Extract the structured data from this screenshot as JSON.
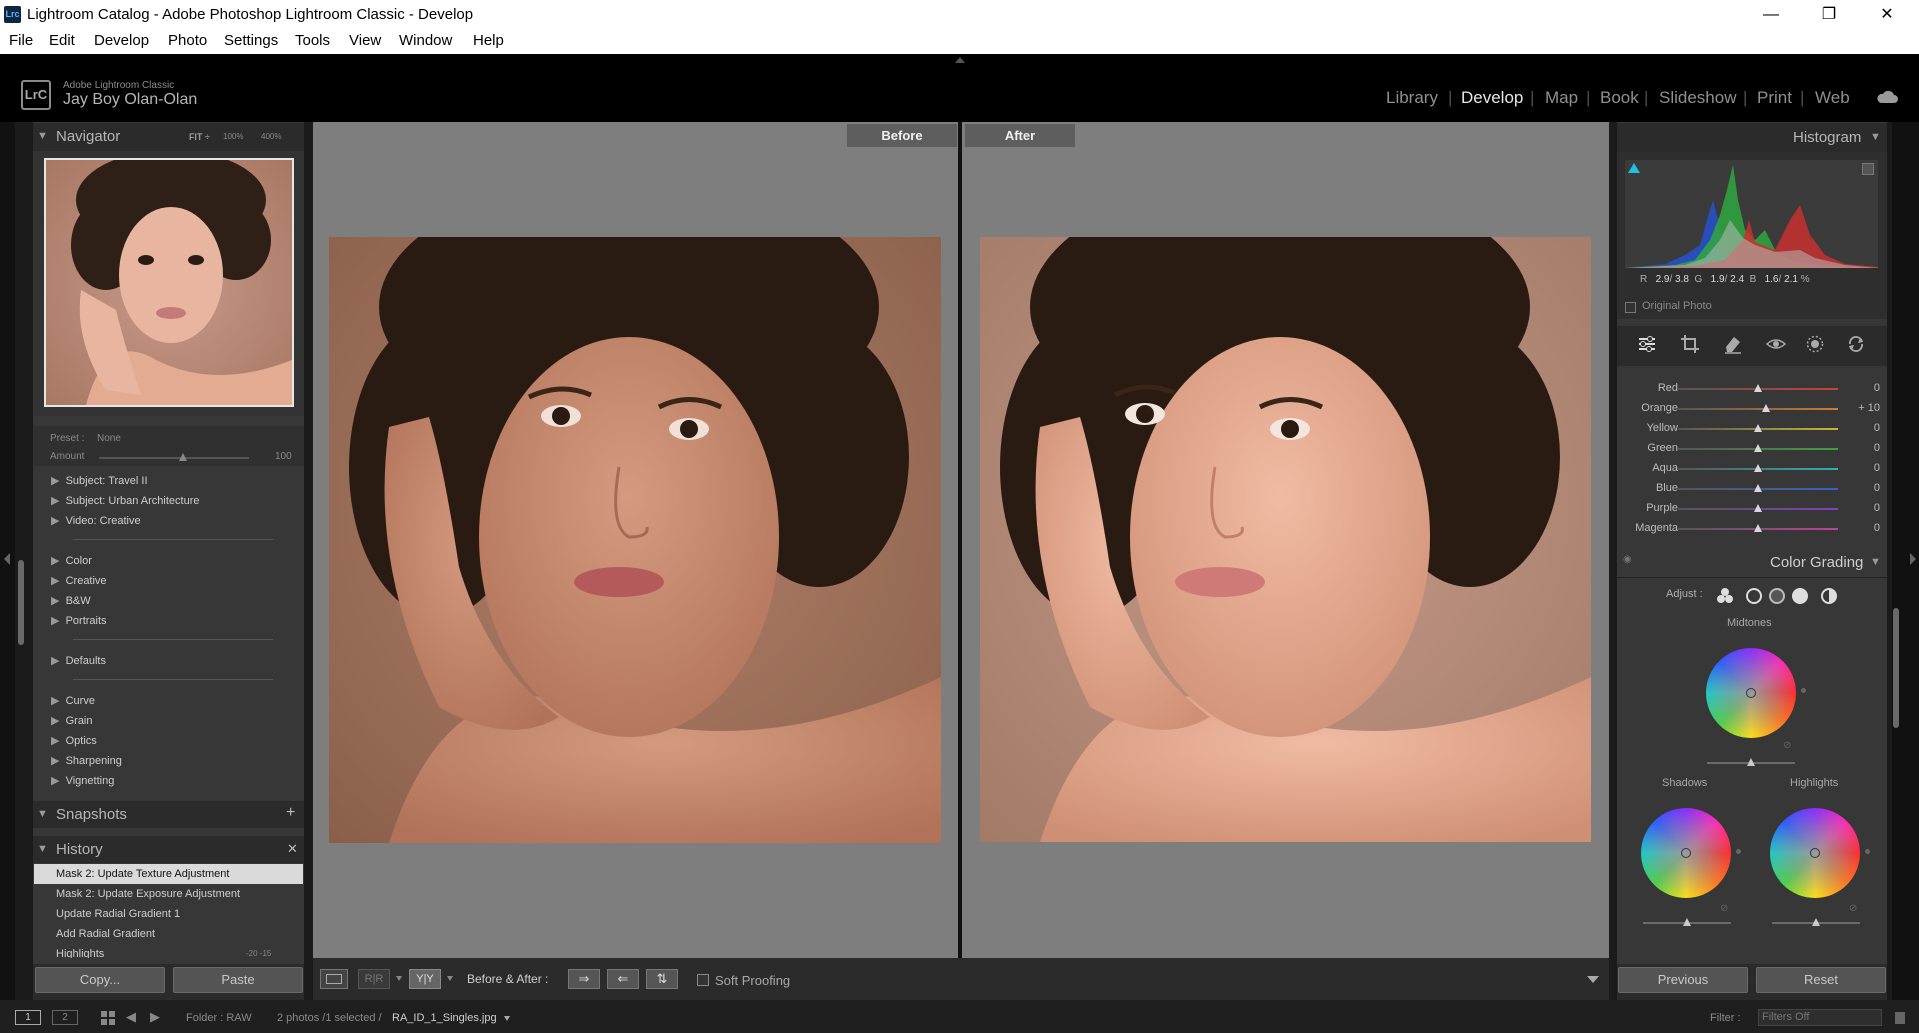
{
  "titlebar": {
    "app_icon": "Lrc",
    "title": "Lightroom Catalog - Adobe Photoshop Lightroom Classic - Develop"
  },
  "window_controls": {
    "minimize": "—",
    "maximize": "❐",
    "close": "✕"
  },
  "menu": [
    "File",
    "Edit",
    "Develop",
    "Photo",
    "Settings",
    "Tools",
    "View",
    "Window",
    "Help"
  ],
  "identity": {
    "logo": "LrC",
    "small": "Adobe Lightroom Classic",
    "name": "Jay Boy Olan-Olan"
  },
  "modules": [
    "Library",
    "Develop",
    "Map",
    "Book",
    "Slideshow",
    "Print",
    "Web"
  ],
  "active_module": "Develop",
  "navigator": {
    "title": "Navigator",
    "zoom_fit": "FIT ÷",
    "zoom_100": "100%",
    "zoom_400": "400%"
  },
  "preset": {
    "label": "Preset :",
    "value": "None",
    "amount_label": "Amount",
    "amount_value": "100",
    "amount_fraction": 0.56
  },
  "presets": [
    {
      "label": "Subject: Travel II"
    },
    {
      "label": "Subject: Urban Architecture"
    },
    {
      "label": "Video: Creative"
    },
    {
      "label": "Color"
    },
    {
      "label": "Creative"
    },
    {
      "label": "B&W"
    },
    {
      "label": "Portraits"
    },
    {
      "label": "Defaults"
    },
    {
      "label": "Curve"
    },
    {
      "label": "Grain"
    },
    {
      "label": "Optics"
    },
    {
      "label": "Sharpening"
    },
    {
      "label": "Vignetting"
    }
  ],
  "snapshots": {
    "title": "Snapshots",
    "add": "+"
  },
  "history": {
    "title": "History",
    "close": "✕",
    "items": [
      {
        "label": "Mask 2: Update Texture Adjustment"
      },
      {
        "label": "Mask 2: Update Exposure Adjustment"
      },
      {
        "label": "Update Radial Gradient 1"
      },
      {
        "label": "Add Radial Gradient"
      },
      {
        "label": "Highlights",
        "values": "-20   -15"
      }
    ]
  },
  "left_buttons": {
    "copy": "Copy...",
    "paste": "Paste"
  },
  "view": {
    "before_label": "Before",
    "after_label": "After"
  },
  "toolbar": {
    "yy": "Y|Y",
    "before_after": "Before & After :",
    "soft_proofing": "Soft Proofing"
  },
  "histogram": {
    "title": "Histogram",
    "readout": {
      "r_label": "R",
      "r": "2.9",
      "r2": "3.8",
      "g_label": "G",
      "g": "1.9",
      "g2": "2.4",
      "b_label": "B",
      "b": "1.6",
      "b2": "2.1",
      "unit": "%"
    },
    "original_photo": "Original Photo"
  },
  "hsl": [
    {
      "label": "Red",
      "value": "0",
      "pos": 0.5,
      "color": "#c84040"
    },
    {
      "label": "Orange",
      "value": "+ 10",
      "pos": 0.55,
      "color": "#d07a30"
    },
    {
      "label": "Yellow",
      "value": "0",
      "pos": 0.5,
      "color": "#c8b830"
    },
    {
      "label": "Green",
      "value": "0",
      "pos": 0.5,
      "color": "#40a040"
    },
    {
      "label": "Aqua",
      "value": "0",
      "pos": 0.5,
      "color": "#30b0b0"
    },
    {
      "label": "Blue",
      "value": "0",
      "pos": 0.5,
      "color": "#3a60c8"
    },
    {
      "label": "Purple",
      "value": "0",
      "pos": 0.5,
      "color": "#8040c0"
    },
    {
      "label": "Magenta",
      "value": "0",
      "pos": 0.5,
      "color": "#c040a0"
    }
  ],
  "color_grading": {
    "title": "Color Grading",
    "adjust_label": "Adjust :",
    "midtones": "Midtones",
    "shadows": "Shadows",
    "highlights": "Highlights"
  },
  "right_buttons": {
    "previous": "Previous",
    "reset": "Reset"
  },
  "filmstrip": {
    "screen1": "1",
    "screen2": "2",
    "folder": "Folder : RAW",
    "count": "2 photos /1 selected /",
    "filename": "RA_ID_1_Singles.jpg",
    "filter_label": "Filter :",
    "filter_value": "Filters Off"
  }
}
